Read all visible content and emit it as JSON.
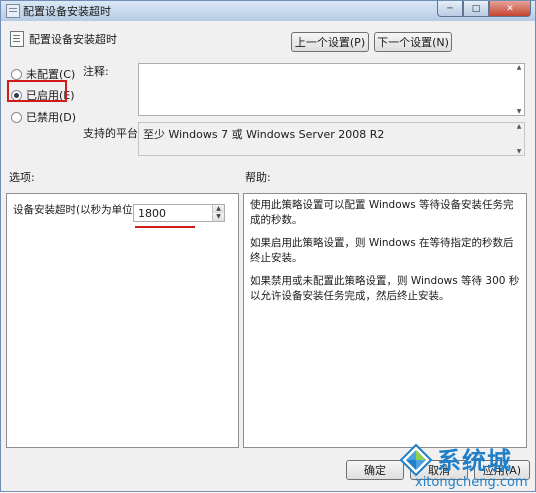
{
  "window": {
    "title": "配置设备安装超时",
    "controls": {
      "minimize": "─",
      "maximize": "□",
      "close": "✕"
    }
  },
  "header": {
    "policy_title": "配置设备安装超时",
    "prev_button": "上一个设置(P)",
    "next_button": "下一个设置(N)"
  },
  "state": {
    "options": [
      {
        "label": "未配置(C)",
        "checked": false
      },
      {
        "label": "已启用(E)",
        "checked": true
      },
      {
        "label": "已禁用(D)",
        "checked": false
      }
    ]
  },
  "comment": {
    "label": "注释:",
    "value": ""
  },
  "platform": {
    "label": "支持的平台:",
    "value": "至少 Windows 7 或 Windows Server 2008 R2"
  },
  "options_pane": {
    "label": "选项:",
    "field_label": "设备安装超时(以秒为单位)",
    "field_value": "1800"
  },
  "help_pane": {
    "label": "帮助:",
    "paragraphs": [
      "使用此策略设置可以配置 Windows 等待设备安装任务完成的秒数。",
      "如果启用此策略设置，则 Windows 在等待指定的秒数后终止安装。",
      "如果禁用或未配置此策略设置，则 Windows 等待 300 秒以允许设备安装任务完成，然后终止安装。"
    ]
  },
  "footer": {
    "ok_button": "确定",
    "cancel_button": "取消",
    "apply_button": "应用(A)"
  },
  "watermark": {
    "name": "系统城",
    "url": "xitongcheng.com"
  },
  "colors": {
    "highlight": "#d11b1b",
    "watermark": "#1f7fc9"
  }
}
